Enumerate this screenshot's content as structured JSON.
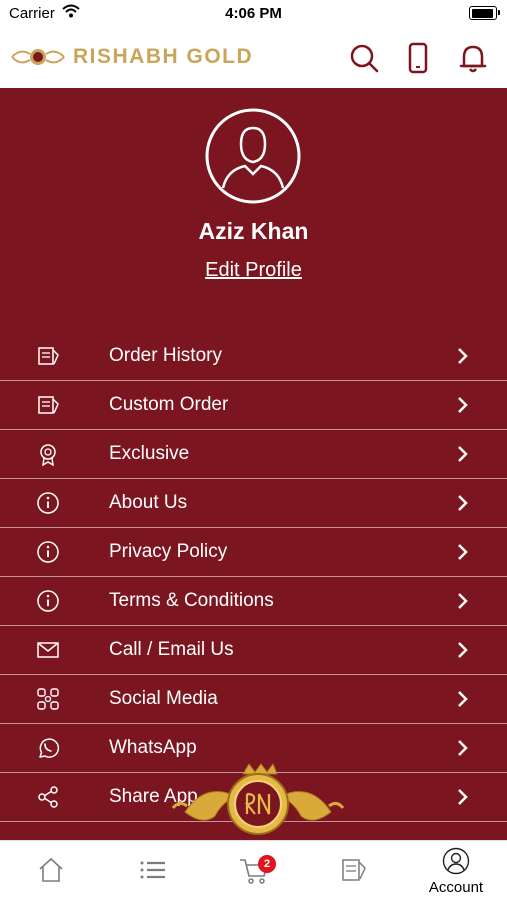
{
  "status_bar": {
    "carrier": "Carrier",
    "time": "4:06 PM"
  },
  "header": {
    "brand": "RISHABH GOLD"
  },
  "profile": {
    "name": "Aziz Khan",
    "edit_label": "Edit Profile"
  },
  "menu": [
    {
      "label": "Order History",
      "icon": "order-history-icon"
    },
    {
      "label": "Custom Order",
      "icon": "custom-order-icon"
    },
    {
      "label": "Exclusive",
      "icon": "medal-icon"
    },
    {
      "label": "About Us",
      "icon": "info-icon"
    },
    {
      "label": "Privacy Policy",
      "icon": "info-icon"
    },
    {
      "label": "Terms & Conditions",
      "icon": "info-icon"
    },
    {
      "label": "Call / Email Us",
      "icon": "mail-icon"
    },
    {
      "label": "Social Media",
      "icon": "social-icon"
    },
    {
      "label": "WhatsApp",
      "icon": "whatsapp-icon"
    },
    {
      "label": "Share App",
      "icon": "share-icon"
    }
  ],
  "tab_bar": {
    "cart_badge": "2",
    "account_label": "Account"
  },
  "colors": {
    "primary": "#7b1620",
    "gold": "#c9a55c",
    "badge": "#e0141e"
  }
}
